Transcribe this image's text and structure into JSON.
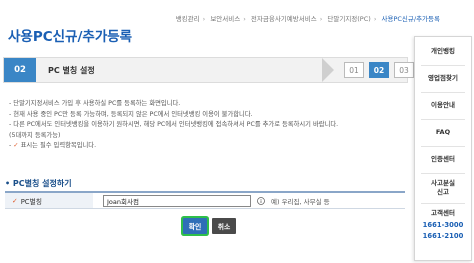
{
  "breadcrumb": [
    "뱅킹관리",
    "보안서비스",
    "전자금융사기예방서비스",
    "단말기지정(PC)",
    "사용PC신규/추가등록"
  ],
  "page_title": "사용PC신규/추가등록",
  "stepbar": {
    "current_number": "02",
    "current_title": "PC 별칭 설정",
    "steps": [
      "01",
      "02",
      "03"
    ],
    "active_step": "02"
  },
  "notes": [
    "- 단말기지정서비스 가입 후 사용하실 PC를 등록하는 화면입니다.",
    "- 현재 사용 중인 PC만 등록 가능하며, 등록되지 않은 PC에서 인터넷뱅킹 이용이 불가합니다.",
    "- 다른 PC에서도 인터넷뱅킹을 이용하기 원하시면, 해당 PC에서 인터넷뱅킹에 접속하셔서 PC를 추가로 등록하시기 바랍니다.",
    "  (5대까지 등록가능)"
  ],
  "required_note": "표시는 필수 입력항목입니다.",
  "required_mark": "✓",
  "section_title": "• PC별칭 설정하기",
  "form": {
    "label": "PC별칭",
    "input_value": "Joan회사컴",
    "example": "예) 우리집, 사무실 등",
    "info_icon": "info-circle-icon"
  },
  "buttons": {
    "confirm": "확인",
    "cancel": "취소"
  },
  "quickmenu": {
    "items": [
      "개인뱅킹",
      "영업점찾기",
      "이용안내",
      "FAQ",
      "인증센터",
      "사고분실",
      "신고",
      "고객센터"
    ],
    "phones": [
      "1661-3000",
      "1661-2100"
    ]
  },
  "colors": {
    "brand_blue": "#1a5fb4",
    "step_blue": "#3a86c6",
    "required_orange": "#e05b2a",
    "confirm_focus_ring": "#2fbf4a"
  }
}
